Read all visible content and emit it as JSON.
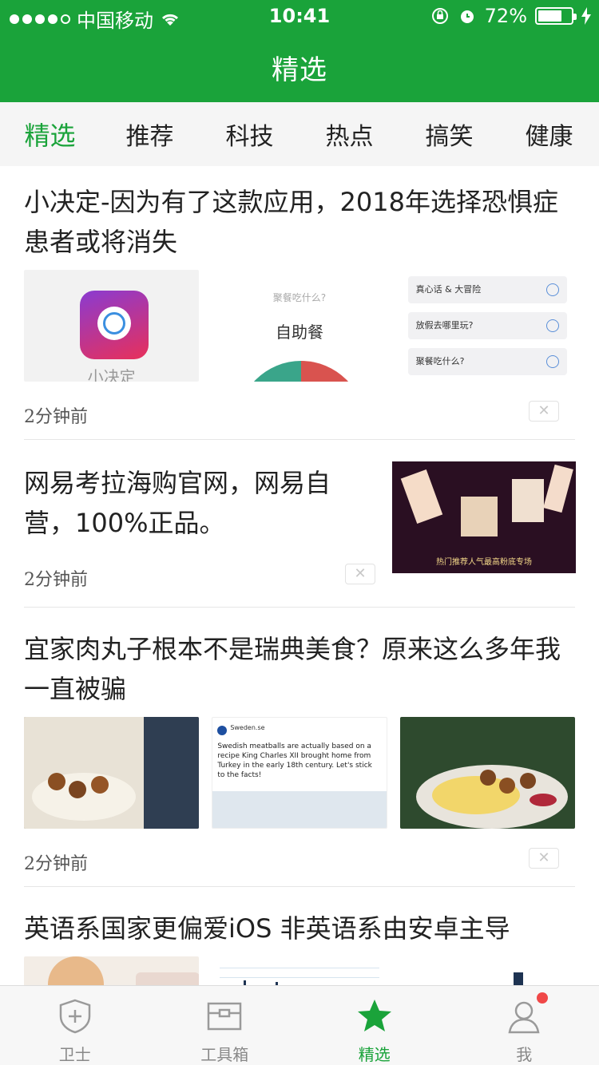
{
  "status_bar": {
    "carrier": "中国移动",
    "time": "10:41",
    "battery": "72%",
    "battery_level": 0.72
  },
  "header": {
    "title": "精选"
  },
  "tabs": [
    {
      "label": "精选",
      "active": true
    },
    {
      "label": "推荐",
      "active": false
    },
    {
      "label": "科技",
      "active": false
    },
    {
      "label": "热点",
      "active": false
    },
    {
      "label": "搞笑",
      "active": false
    },
    {
      "label": "健康",
      "active": false
    }
  ],
  "articles": [
    {
      "title": "小决定-因为有了这款应用，2018年选择恐惧症患者或将消失",
      "time": "2分钟前",
      "images": {
        "app_name": "小决定",
        "wheel_question": "聚餐吃什么?",
        "wheel_answer": "自助餐",
        "list_items": [
          "真心话 & 大冒险",
          "放假去哪里玩?",
          "聚餐吃什么?"
        ]
      }
    },
    {
      "title": "网易考拉海购官网，网易自营，100%正品。",
      "time": "2分钟前",
      "image_caption": "热门推荐人气最高粉底专场"
    },
    {
      "title": "宜家肉丸子根本不是瑞典美食？原来这么多年我一直被骗",
      "time": "2分钟前",
      "tweet": {
        "account": "Sweden.se",
        "text": "Swedish meatballs are actually based on a recipe King Charles XII brought home from Turkey in the early 18th century. Let's stick to the facts!"
      }
    },
    {
      "title": "英语系国家更偏爱iOS 非英语系由安卓主导"
    }
  ],
  "bottom_nav": [
    {
      "label": "卫士",
      "icon": "shield-plus-icon",
      "active": false
    },
    {
      "label": "工具箱",
      "icon": "toolbox-icon",
      "active": false
    },
    {
      "label": "精选",
      "icon": "star-icon",
      "active": true
    },
    {
      "label": "我",
      "icon": "person-icon",
      "active": false,
      "badge": true
    }
  ],
  "colors": {
    "brand_green": "#1aa33a",
    "badge_red": "#f04848"
  }
}
